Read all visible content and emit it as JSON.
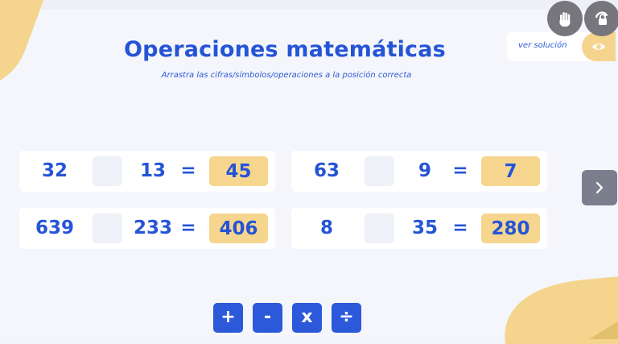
{
  "title": "Operaciones matemáticas",
  "subtitle": "Arrastra las cifras/símbolos/operaciones a la posición correcta",
  "solution_label": "ver solución",
  "equations": [
    {
      "a": "32",
      "b": "13",
      "eq": "=",
      "result": "45"
    },
    {
      "a": "63",
      "b": "9",
      "eq": "=",
      "result": "7"
    },
    {
      "a": "639",
      "b": "233",
      "eq": "=",
      "result": "406"
    },
    {
      "a": "8",
      "b": "35",
      "eq": "=",
      "result": "280"
    }
  ],
  "operators": [
    "+",
    "-",
    "x",
    "÷"
  ],
  "colors": {
    "primary_blue": "#2554d6",
    "result_yellow": "#f6d68f",
    "background": "#f4f6fc",
    "blob_yellow": "#f5d58e"
  },
  "icons": {
    "hand": "hand-icon",
    "rotate": "rotate-lock-icon",
    "eye": "eye-icon",
    "next": "chevron-right-icon"
  }
}
